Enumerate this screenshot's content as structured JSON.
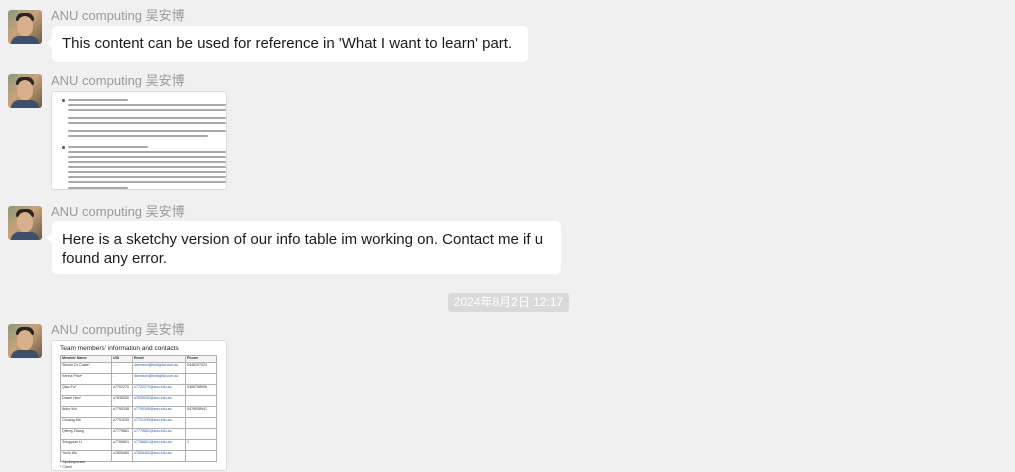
{
  "messages": [
    {
      "sender": "ANU computing 吴安博",
      "type": "text",
      "text": "This content can be used for reference in 'What I want to learn' part."
    },
    {
      "sender": "ANU computing 吴安博",
      "type": "image",
      "image_desc": "document-screenshot"
    },
    {
      "sender": "ANU computing 吴安博",
      "type": "text",
      "text": "Here is a sketchy version of our info table im working on. Contact me if u found any error."
    },
    {
      "sender": "ANU computing 吴安博",
      "type": "image",
      "image_desc": "table-screenshot"
    }
  ],
  "timestamp": "2024年8月2日 12:17",
  "table_image": {
    "title": "Team members' information and contacts",
    "columns": [
      "Member Name",
      "UID",
      "Email",
      "Phone"
    ],
    "rows": [
      [
        "Steven Dr Costa*",
        "-",
        "dsemsen@tmdigital.com.au",
        "0448197023"
      ],
      [
        "Kenna Prior*",
        "-",
        "dsemsen@tmdigital.com.au",
        ""
      ],
      [
        "Qiao Fu*",
        "u7702270",
        "u7702270@anu.edu.au",
        "0466758996"
      ],
      [
        "Dawei Hao*",
        "u7635030",
        "u7635030@anu.edu.au",
        ""
      ],
      [
        "Anbo Wu",
        "u7790348",
        "u7790348@anu.edu.au",
        "0478938941"
      ],
      [
        "Chuang Ma",
        "u7701039",
        "u7701039@anu.edu.au",
        ""
      ],
      [
        "Qifeng Zhang",
        "u7779881",
        "u7779881@anu.edu.au",
        ""
      ],
      [
        "Songyuan Li",
        "u7766801",
        "u7766801@anu.edu.au",
        "1"
      ],
      [
        "Yuxin Wu",
        "u7605460",
        "u7605460@anu.edu.au",
        ""
      ]
    ],
    "footnotes": [
      "* Spokesperson",
      "* Client"
    ]
  },
  "colors": {
    "background": "#f0f0f0",
    "bubble": "#ffffff",
    "sender": "#9a9a9a",
    "timestamp_bg": "#dadada"
  }
}
